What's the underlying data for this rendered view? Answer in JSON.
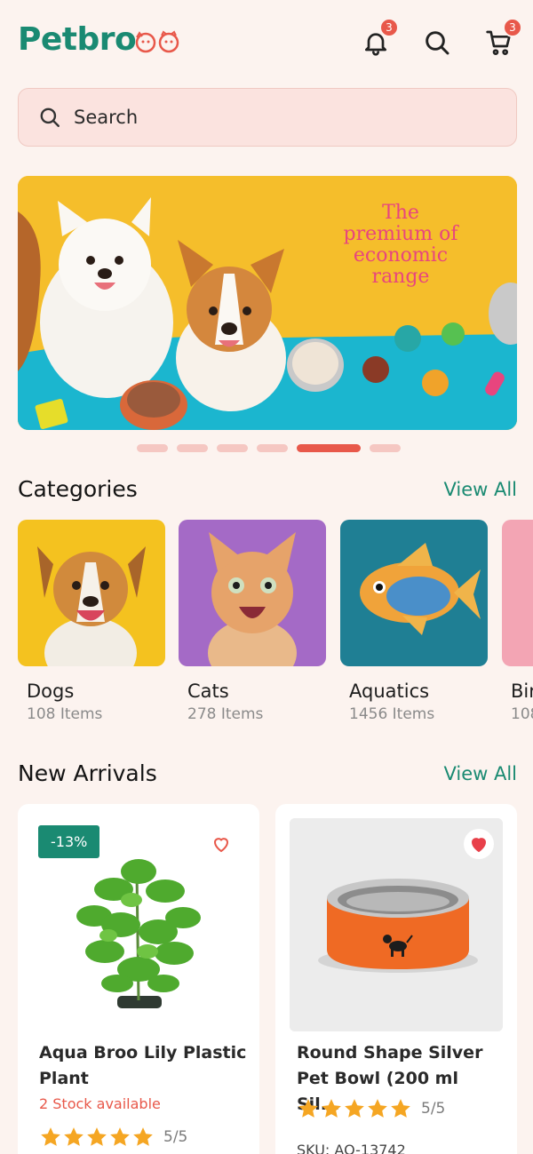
{
  "header": {
    "logo_text": "Petbro",
    "notifications_count": "3",
    "cart_count": "3"
  },
  "search": {
    "label": "Search"
  },
  "banner": {
    "lines": [
      "The",
      "premium of",
      "economic",
      "range"
    ],
    "slides_total": 7,
    "active_slide": 5
  },
  "categories": {
    "title": "Categories",
    "view_all": "View All",
    "items": [
      {
        "name": "Dogs",
        "count": "108 Items"
      },
      {
        "name": "Cats",
        "count": "278 Items"
      },
      {
        "name": "Aquatics",
        "count": "1456 Items"
      },
      {
        "name": "Bir",
        "count": "108"
      }
    ]
  },
  "new_arrivals": {
    "title": "New Arrivals",
    "view_all": "View All",
    "products": [
      {
        "discount": "-13%",
        "name_line1": "Aqua Broo Lily Plastic",
        "name_line2": "Plant",
        "stock": "2 Stock available",
        "rating": "5/5",
        "favorited": false
      },
      {
        "name_line1": "Round Shape Silver",
        "name_line2": "Pet Bowl (200 ml Sil...",
        "rating": "5/5",
        "sku": "SKU: AQ-13742",
        "favorited": true
      }
    ]
  },
  "colors": {
    "brand_green": "#1a8a72",
    "accent_red": "#e8584a",
    "background": "#fcf3ef",
    "star": "#f5a623"
  }
}
